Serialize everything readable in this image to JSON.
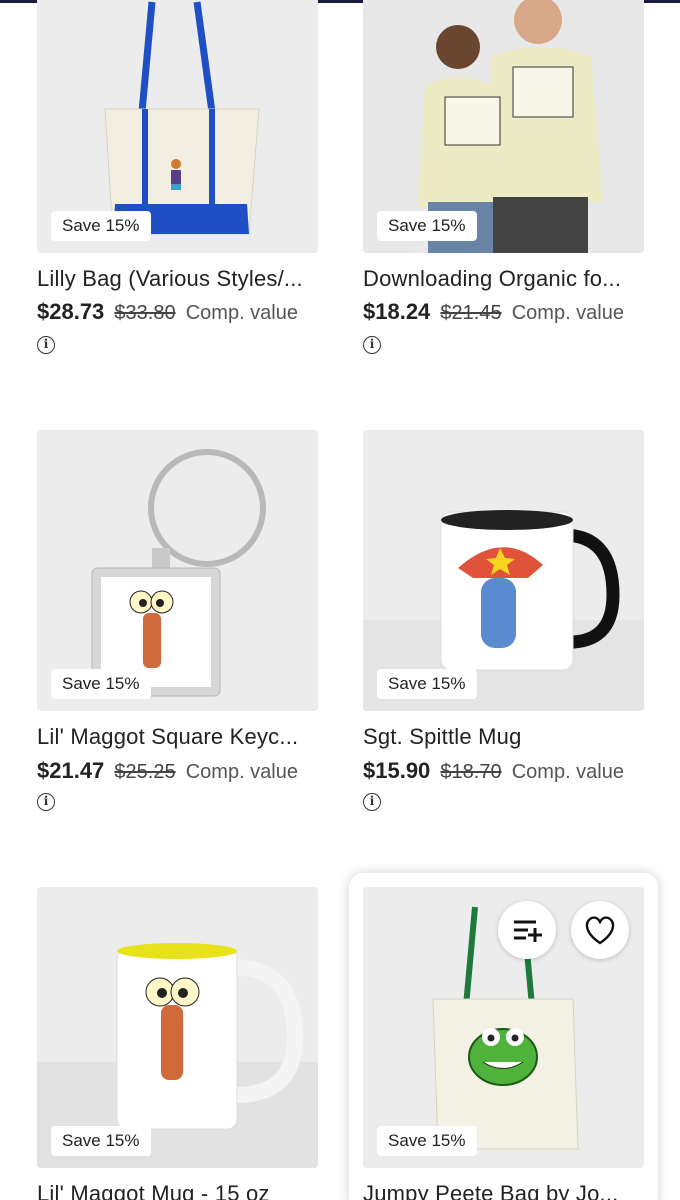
{
  "products": [
    {
      "title": "Lilly Bag (Various Styles/...",
      "price": "$28.73",
      "original_price": "$33.80",
      "comp_label": "Comp. value",
      "badge": "Save 15%"
    },
    {
      "title": "Downloading Organic fo...",
      "price": "$18.24",
      "original_price": "$21.45",
      "comp_label": "Comp. value",
      "badge": "Save 15%"
    },
    {
      "title": "Lil' Maggot Square Keyc...",
      "price": "$21.47",
      "original_price": "$25.25",
      "comp_label": "Comp. value",
      "badge": "Save 15%"
    },
    {
      "title": "Sgt. Spittle Mug",
      "price": "$15.90",
      "original_price": "$18.70",
      "comp_label": "Comp. value",
      "badge": "Save 15%"
    },
    {
      "title": "Lil' Maggot Mug - 15 oz",
      "price": "",
      "original_price": "",
      "comp_label": "",
      "badge": "Save 15%"
    },
    {
      "title": "Jumpy Peete Bag by Jo...",
      "price": "",
      "original_price": "",
      "comp_label": "",
      "badge": "Save 15%"
    }
  ],
  "info_icon_glyph": "i",
  "colors": {
    "accent_badge_bg": "#ffffff",
    "tote_blue": "#1f4fc4",
    "tote_green": "#1d7a3a"
  },
  "icons": [
    "info-icon",
    "add-to-list-icon",
    "heart-icon"
  ]
}
